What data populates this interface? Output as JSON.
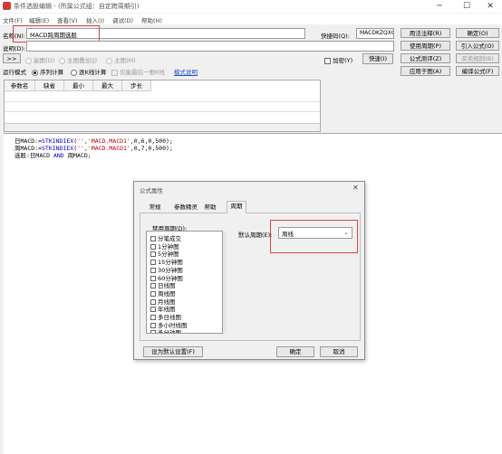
{
  "window": {
    "title": "条件选股编辑 - (所属公式组：自定跨周期引)",
    "minimize": "─",
    "maximize": "☐",
    "close": "✕"
  },
  "menu": [
    "文件(F)",
    "编辑(E)",
    "查看(V)",
    "插入(I)",
    "调试(D)",
    "帮助(H)"
  ],
  "form": {
    "name_label": "名称(N):",
    "name_value": "MACD跨周期选股",
    "shortcut_label": "快捷码(Q):",
    "shortcut_value": "MACDKZQXG",
    "desc_label": "说明(D):",
    "desc_value": "",
    "nav_button": ">>",
    "opt_subchart": "副图(O)",
    "opt_overlay": "主图叠加(J)",
    "opt_mainchart": "主图(M)",
    "encrypt_label": "加密(Y)",
    "speed_button": "快速(I)",
    "runmode_label": "运行模式",
    "runmode_sequence": "序列计算",
    "runmode_stepwise": "逐K线计算",
    "runmode_lastbar": "仅能最后一根K线",
    "mode_help_link": "模式说明"
  },
  "side_buttons": [
    [
      "用法注释(R)",
      "确定(O)"
    ],
    [
      "使用周期(P)",
      "引入公式(O)"
    ],
    [
      "公式测评(Z)",
      "买卖规则(B)"
    ],
    [
      "应用于图(A)",
      "编译公式(F)"
    ]
  ],
  "side_disabled": "买卖规则(B)",
  "params": {
    "headers": [
      "参数名",
      "缺省",
      "最小",
      "最大",
      "步长"
    ]
  },
  "editor": {
    "lines": [
      [
        {
          "t": "日MACD:="
        },
        {
          "t": "STKINDIEX",
          "c": "kw"
        },
        {
          "t": "("
        },
        {
          "t": "''",
          "c": "str"
        },
        {
          "t": ","
        },
        {
          "t": "'MACD.MACD1'",
          "c": "str"
        },
        {
          "t": ",0,6,0,500);"
        }
      ],
      [
        {
          "t": "周MACD:="
        },
        {
          "t": "STKINDIEX",
          "c": "kw"
        },
        {
          "t": "("
        },
        {
          "t": "''",
          "c": "str"
        },
        {
          "t": ","
        },
        {
          "t": "'MACD.MACD1'",
          "c": "str"
        },
        {
          "t": ",0,7,0,500);"
        }
      ],
      [
        {
          "t": "选股:日MACD "
        },
        {
          "t": "AND",
          "c": "kw"
        },
        {
          "t": " 周MACD;"
        }
      ]
    ]
  },
  "dialog": {
    "title": "公式属性",
    "close": "✕",
    "tabs": [
      "常规",
      "参数精灵",
      "帮助",
      "周期"
    ],
    "active_tab": "周期",
    "disabled_label": "禁用周期(D):",
    "disabled_periods": [
      "分笔成交",
      "1分钟图",
      "5分钟图",
      "15分钟图",
      "30分钟图",
      "60分钟图",
      "日线图",
      "周线图",
      "月线图",
      "年线图",
      "多日线图",
      "多小时线图",
      "多分钟图"
    ],
    "default_period_label": "默认周期(E):",
    "default_period_value": "周线",
    "reset_button": "设为默认设置(F)",
    "ok_button": "确定",
    "cancel_button": "取消"
  }
}
